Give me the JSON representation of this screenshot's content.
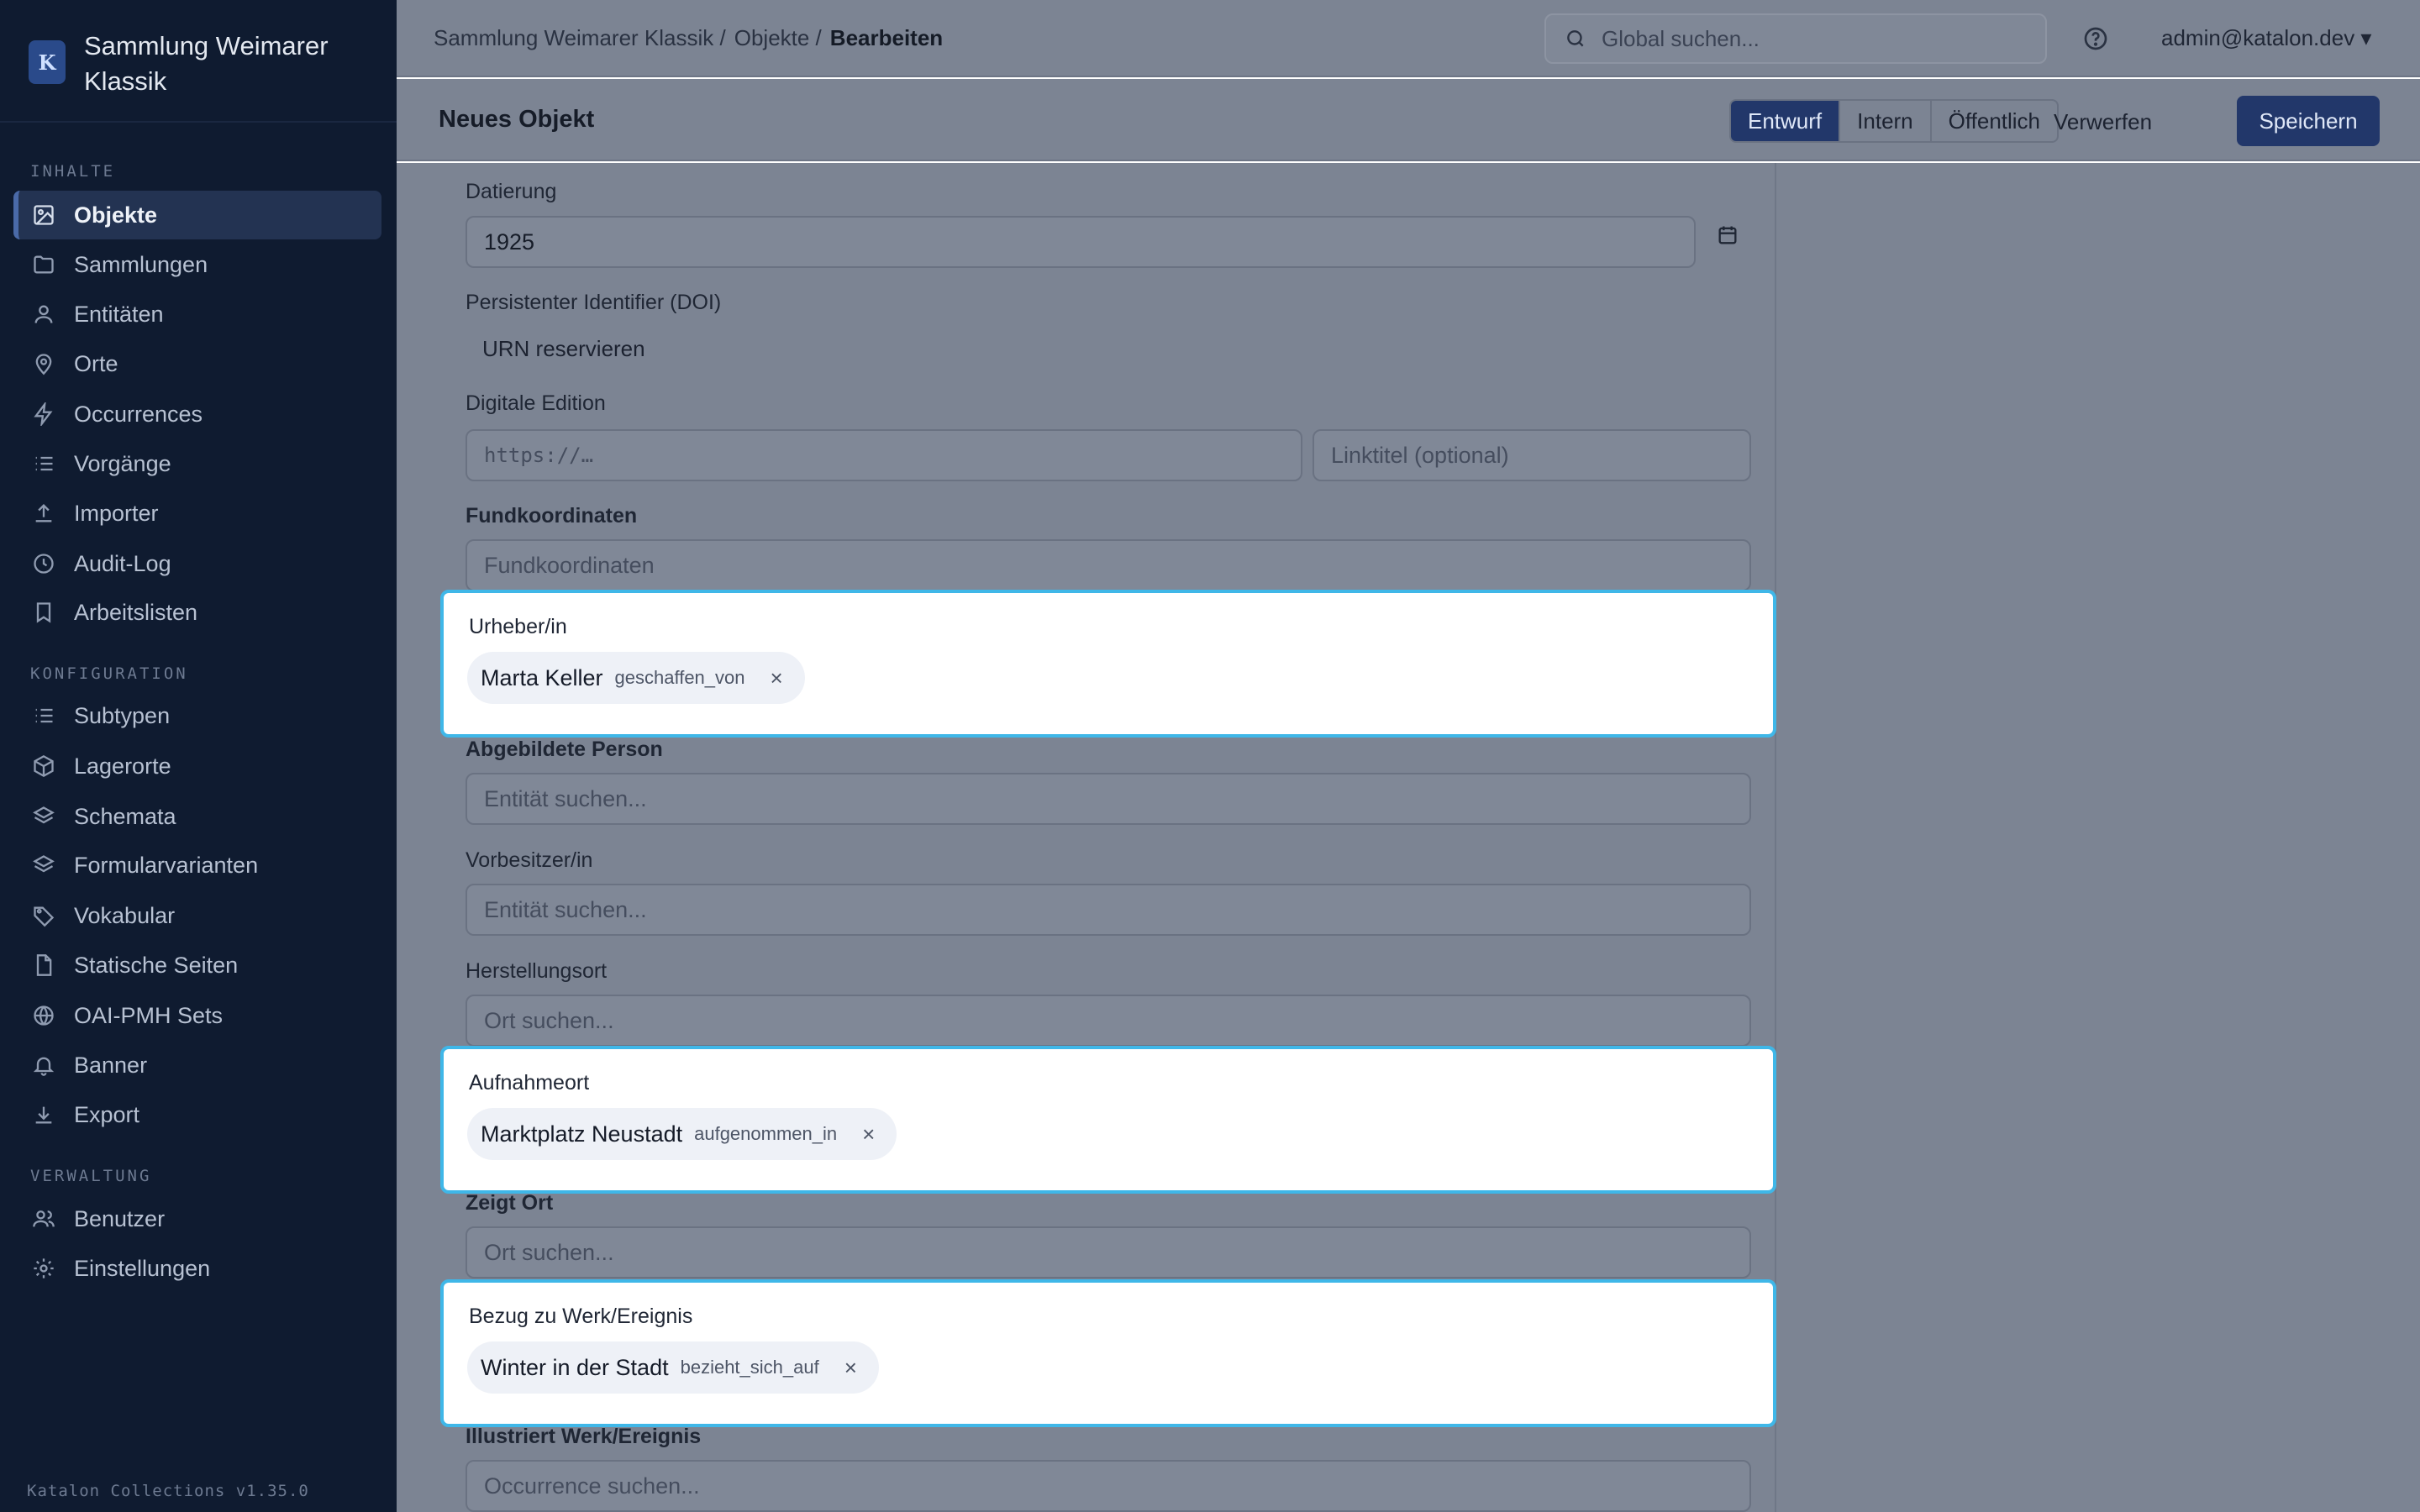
{
  "sidebar": {
    "brand_logo": "K",
    "brand_title": "Sammlung Weimarer Klassik",
    "sections": {
      "inhalte": "INHALTE",
      "konfiguration": "KONFIGURATION",
      "verwaltung": "VERWALTUNG"
    },
    "items": {
      "objekte": "Objekte",
      "sammlungen": "Sammlungen",
      "entitaeten": "Entitäten",
      "orte": "Orte",
      "occurrences": "Occurrences",
      "vorgaenge": "Vorgänge",
      "importer": "Importer",
      "audit_log": "Audit-Log",
      "arbeitslisten": "Arbeitslisten",
      "subtypen": "Subtypen",
      "lagerorte": "Lagerorte",
      "schemata": "Schemata",
      "formularvarianten": "Formularvarianten",
      "vokabular": "Vokabular",
      "statische_seiten": "Statische Seiten",
      "oai_pmh_sets": "OAI-PMH Sets",
      "banner": "Banner",
      "export": "Export",
      "benutzer": "Benutzer",
      "einstellungen": "Einstellungen"
    },
    "version": "Katalon Collections v1.35.0"
  },
  "topbar": {
    "breadcrumb": [
      "Sammlung Weimarer Klassik /",
      "Objekte /",
      "Bearbeiten"
    ],
    "search_placeholder": "Global suchen...",
    "user": "admin@katalon.dev ▾"
  },
  "header": {
    "title": "Neues Objekt",
    "status": [
      "Entwurf",
      "Intern",
      "Öffentlich"
    ],
    "discard": "Verwerfen",
    "save": "Speichern"
  },
  "form": {
    "datierung": {
      "label": "Datierung",
      "value": "1925"
    },
    "doi": {
      "label": "Persistenter Identifier (DOI)",
      "action": "URN reservieren"
    },
    "edition": {
      "label": "Digitale Edition",
      "url_placeholder": "https://…",
      "title_placeholder": "Linktitel (optional)"
    },
    "fundkoordinaten": {
      "label": "Fundkoordinaten",
      "placeholder": "Fundkoordinaten"
    },
    "urheber": {
      "label": "Urheber/in",
      "chip_name": "Marta Keller",
      "chip_rel": "geschaffen_von"
    },
    "abgebildete_person": {
      "label": "Abgebildete Person",
      "placeholder": "Entität suchen..."
    },
    "vorbesitzer": {
      "label": "Vorbesitzer/in",
      "placeholder": "Entität suchen..."
    },
    "herstellungsort": {
      "label": "Herstellungsort",
      "placeholder": "Ort suchen..."
    },
    "aufnahmeort": {
      "label": "Aufnahmeort",
      "chip_name": "Marktplatz Neustadt",
      "chip_rel": "aufgenommen_in"
    },
    "zeigt_ort": {
      "label": "Zeigt Ort",
      "placeholder": "Ort suchen..."
    },
    "bezug": {
      "label": "Bezug zu Werk/Ereignis",
      "chip_name": "Winter in der Stadt",
      "chip_rel": "bezieht_sich_auf"
    },
    "illustriert": {
      "label": "Illustriert Werk/Ereignis",
      "placeholder": "Occurrence suchen..."
    },
    "chip_remove": "×"
  }
}
